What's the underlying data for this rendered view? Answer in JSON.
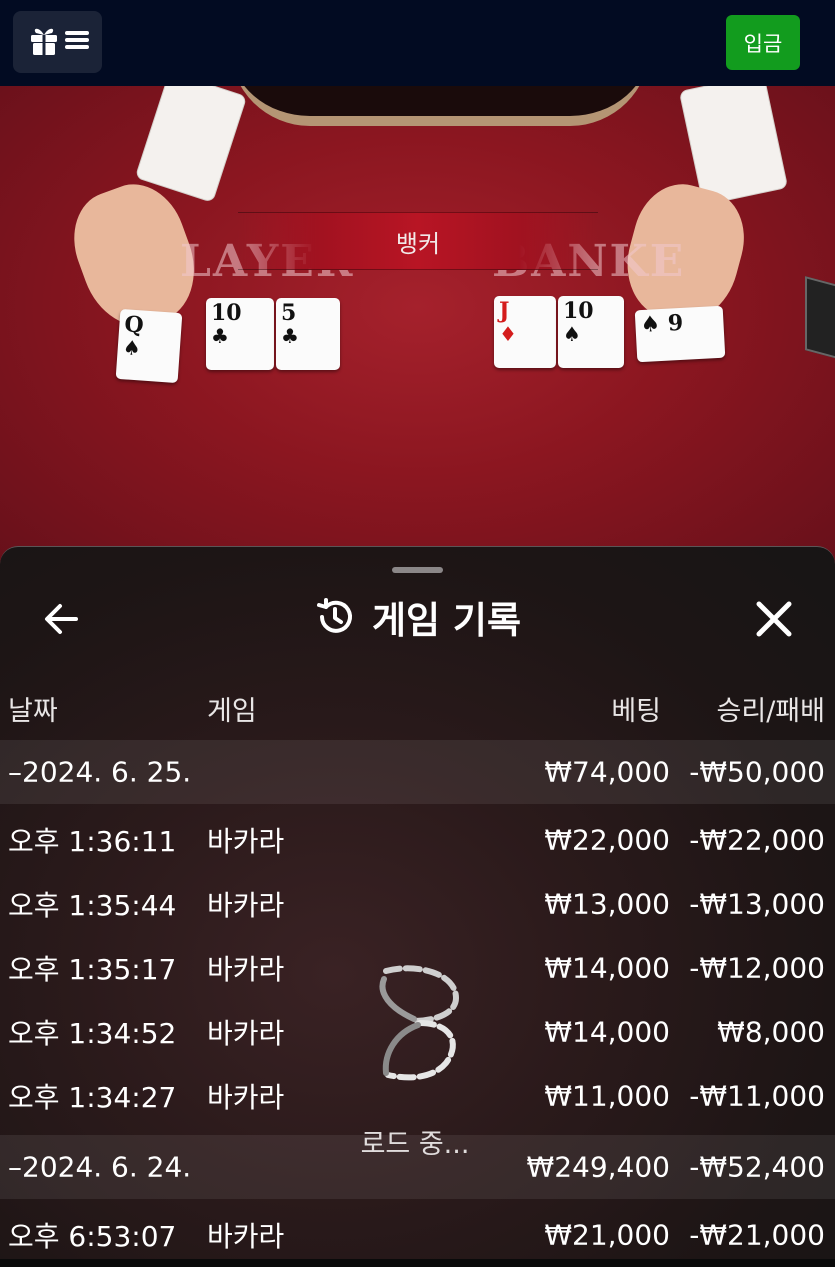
{
  "header": {
    "deposit_label": "입금"
  },
  "video": {
    "banner_text": "뱅커",
    "player_table_text": "LAYER",
    "banker_table_text": "BANKE",
    "player_cards": [
      {
        "rank": "Q",
        "suit": "♠",
        "color": "black"
      },
      {
        "rank": "10",
        "suit": "♣",
        "color": "black"
      },
      {
        "rank": "5",
        "suit": "♣",
        "color": "black"
      }
    ],
    "banker_cards": [
      {
        "rank": "J",
        "suit": "♦",
        "color": "red"
      },
      {
        "rank": "10",
        "suit": "♠",
        "color": "black"
      },
      {
        "rank": "9",
        "suit": "♠",
        "color": "black"
      }
    ]
  },
  "history": {
    "title": "게임 기록",
    "columns": {
      "date": "날짜",
      "game": "게임",
      "bet": "베팅",
      "result": "승리/패배"
    },
    "rows": [
      {
        "type": "date",
        "date": "–2024. 6. 25.",
        "game": "",
        "bet": "₩74,000",
        "result": "-₩50,000"
      },
      {
        "type": "item",
        "date": "오후 1:36:11",
        "game": "바카라",
        "bet": "₩22,000",
        "result": "-₩22,000"
      },
      {
        "type": "item",
        "date": "오후 1:35:44",
        "game": "바카라",
        "bet": "₩13,000",
        "result": "-₩13,000"
      },
      {
        "type": "item",
        "date": "오후 1:35:17",
        "game": "바카라",
        "bet": "₩14,000",
        "result": "-₩12,000"
      },
      {
        "type": "item",
        "date": "오후 1:34:52",
        "game": "바카라",
        "bet": "₩14,000",
        "result": "₩8,000"
      },
      {
        "type": "item",
        "date": "오후 1:34:27",
        "game": "바카라",
        "bet": "₩11,000",
        "result": "-₩11,000"
      },
      {
        "type": "date",
        "date": "–2024. 6. 24.",
        "game": "",
        "bet": "₩249,400",
        "result": "-₩52,400"
      },
      {
        "type": "item",
        "date": "오후 6:53:07",
        "game": "바카라",
        "bet": "₩21,000",
        "result": "-₩21,000"
      }
    ],
    "loading_text": "로드 중..."
  },
  "colors": {
    "topbar": "#020b22",
    "deposit_button": "#129c1e",
    "table_felt": "#8b1620"
  }
}
